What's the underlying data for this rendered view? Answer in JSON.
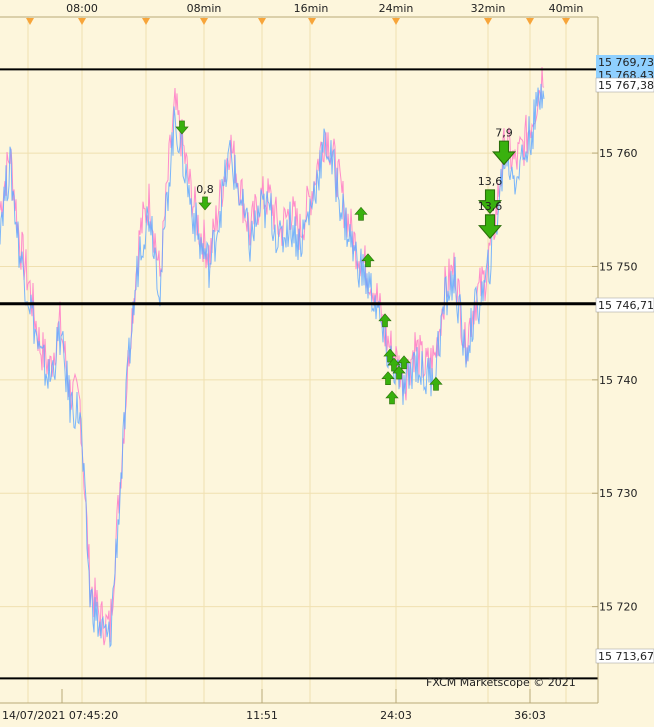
{
  "colors": {
    "background": "#fdf6dc",
    "panel_border": "#b9a978",
    "grid": "#f0e0b0",
    "bid_line": "#ff86c8",
    "ask_line": "#63a9ff",
    "level_line": "#000000",
    "marker_green": "#39b10e",
    "tick_marker": "#f7a53a",
    "price_tag_blue": "#8fd0ff",
    "price_tag_white": "#ffffff"
  },
  "top_axis": {
    "labels": [
      "08:00",
      "08min",
      "16min",
      "24min",
      "32min",
      "40min"
    ]
  },
  "bottom_axis": {
    "labels": [
      "14/07/2021 07:45:20",
      "11:51",
      "24:03",
      "36:03"
    ]
  },
  "watermark": "FXCM Marketscope © 2021",
  "chart_data": {
    "type": "line",
    "instrument_note": "",
    "y_ticks": [
      15760,
      15750,
      15740,
      15730,
      15720
    ],
    "y_tick_labels": [
      "15 760",
      "15 750",
      "15 740",
      "15 730",
      "15 720"
    ],
    "ylim": [
      15711.5,
      15772
    ],
    "x_range_bars": [
      0,
      546
    ],
    "price_tags": [
      {
        "label": "15 769,73",
        "value": 15769.73,
        "style": "blue"
      },
      {
        "label": "15 768,43",
        "value": 15768.43,
        "style": "blue"
      },
      {
        "label": "15 767,38",
        "value": 15767.38,
        "style": "white"
      },
      {
        "label": "15 746,71",
        "value": 15746.71,
        "style": "white"
      },
      {
        "label": "15 713,67",
        "value": 15713.67,
        "style": "white"
      }
    ],
    "horizontal_levels": [
      {
        "value": 15767.38,
        "weight": 2
      },
      {
        "value": 15746.71,
        "weight": 3
      },
      {
        "value": 15713.67,
        "weight": 2
      }
    ],
    "series": [
      {
        "name": "",
        "color": "#ff86c8",
        "x": [
          0,
          10,
          20,
          30,
          40,
          50,
          60,
          70,
          80,
          85,
          90,
          100,
          110,
          120,
          130,
          140,
          150,
          160,
          170,
          175,
          180,
          190,
          200,
          210,
          220,
          230,
          240,
          250,
          260,
          270,
          280,
          290,
          300,
          310,
          320,
          326,
          335,
          345,
          355,
          365,
          375,
          385,
          395,
          405,
          415,
          425,
          435,
          445,
          455,
          465,
          475,
          485,
          495,
          505,
          515,
          525,
          535,
          545
        ],
        "y": [
          15755,
          15760,
          15752,
          15748,
          15743,
          15741,
          15745,
          15739,
          15738,
          15730,
          15722,
          15719,
          15718,
          15731,
          15744,
          15753,
          15756,
          15749,
          15760,
          15764,
          15762,
          15757,
          15753,
          15751,
          15756,
          15761,
          15757,
          15753,
          15756,
          15756,
          15753,
          15755,
          15753,
          15756,
          15760,
          15762,
          15759,
          15755,
          15752,
          15750,
          15748,
          15744,
          15742,
          15740,
          15743,
          15741,
          15742,
          15748,
          15750,
          15743,
          15747,
          15749,
          15754,
          15761,
          15759,
          15761,
          15764,
          15768
        ]
      },
      {
        "name": "",
        "color": "#63a9ff",
        "x": [
          0,
          10,
          20,
          30,
          40,
          50,
          60,
          70,
          80,
          85,
          90,
          100,
          110,
          120,
          130,
          140,
          150,
          160,
          170,
          175,
          180,
          190,
          200,
          210,
          220,
          230,
          240,
          250,
          260,
          270,
          280,
          290,
          300,
          310,
          320,
          326,
          335,
          345,
          355,
          365,
          375,
          385,
          395,
          405,
          415,
          425,
          435,
          445,
          455,
          465,
          475,
          485,
          495,
          505,
          515,
          525,
          535,
          545
        ],
        "y": [
          15754,
          15759,
          15751,
          15747,
          15742,
          15740,
          15744,
          15738,
          15737,
          15729,
          15721,
          15718,
          15717,
          15730,
          15743,
          15752,
          15755,
          15748,
          15759,
          15763,
          15761,
          15756,
          15752,
          15750,
          15755,
          15760,
          15756,
          15752,
          15755,
          15755,
          15752,
          15754,
          15752,
          15755,
          15759,
          15761,
          15758,
          15754,
          15751,
          15749,
          15747,
          15743,
          15741,
          15739,
          15742,
          15740,
          15741,
          15747,
          15749,
          15742,
          15746,
          15748,
          15753,
          15760,
          15758,
          15760,
          15763,
          15767
        ]
      }
    ],
    "trade_markers": [
      {
        "bar": 182,
        "value": 15762.3,
        "dir": "down",
        "size": "small",
        "label": ""
      },
      {
        "bar": 205,
        "value": 15755.6,
        "dir": "down",
        "size": "small",
        "label": "0,8"
      },
      {
        "bar": 361,
        "value": 15754.6,
        "dir": "up",
        "size": "small",
        "label": ""
      },
      {
        "bar": 368,
        "value": 15750.5,
        "dir": "up",
        "size": "small",
        "label": ""
      },
      {
        "bar": 385,
        "value": 15745.2,
        "dir": "up",
        "size": "small",
        "label": ""
      },
      {
        "bar": 390,
        "value": 15742.1,
        "dir": "up",
        "size": "small",
        "label": ""
      },
      {
        "bar": 394,
        "value": 15741.3,
        "dir": "up",
        "size": "small",
        "label": ""
      },
      {
        "bar": 399,
        "value": 15740.6,
        "dir": "up",
        "size": "small",
        "label": ""
      },
      {
        "bar": 404,
        "value": 15741.5,
        "dir": "up",
        "size": "small",
        "label": ""
      },
      {
        "bar": 388,
        "value": 15740.1,
        "dir": "up",
        "size": "small",
        "label": ""
      },
      {
        "bar": 392,
        "value": 15738.4,
        "dir": "up",
        "size": "small",
        "label": ""
      },
      {
        "bar": 436,
        "value": 15739.6,
        "dir": "up",
        "size": "small",
        "label": ""
      },
      {
        "bar": 490,
        "value": 15755.8,
        "dir": "down",
        "size": "big",
        "label": "13,6"
      },
      {
        "bar": 490,
        "value": 15753.6,
        "dir": "down",
        "size": "big",
        "label": "13,6"
      },
      {
        "bar": 504,
        "value": 15760.1,
        "dir": "down",
        "size": "big",
        "label": "7,9"
      }
    ]
  }
}
